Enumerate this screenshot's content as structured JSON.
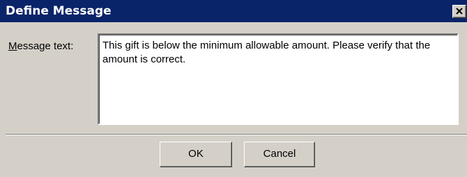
{
  "window": {
    "title": "Define Message"
  },
  "form": {
    "label_prefix": "M",
    "label_rest": "essage text:",
    "message_text": "This gift is below the minimum allowable amount.  Please verify that the amount is correct."
  },
  "buttons": {
    "ok_label": "OK",
    "cancel_label": "Cancel"
  },
  "icons": {
    "close": "close-icon"
  },
  "colors": {
    "titlebar": "#0a246a",
    "title_text": "#ffffff",
    "dialog_face": "#d4d0c8",
    "text_area": "#ffffff"
  }
}
